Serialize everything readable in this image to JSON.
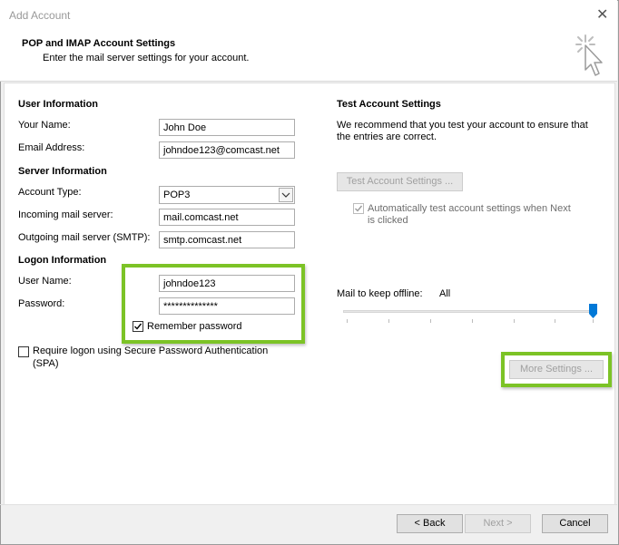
{
  "window": {
    "title": "Add Account",
    "close_glyph": "✕"
  },
  "header": {
    "title": "POP and IMAP Account Settings",
    "subtitle": "Enter the mail server settings for your account.",
    "icon": "cursor-click-icon"
  },
  "user_info": {
    "section_title": "User Information",
    "name_label": "Your Name:",
    "name_value": "John Doe",
    "email_label": "Email Address:",
    "email_value": "johndoe123@comcast.net"
  },
  "server_info": {
    "section_title": "Server Information",
    "account_type_label": "Account Type:",
    "account_type_value": "POP3",
    "incoming_label": "Incoming mail server:",
    "incoming_value": "mail.comcast.net",
    "outgoing_label": "Outgoing mail server (SMTP):",
    "outgoing_value": "smtp.comcast.net"
  },
  "logon_info": {
    "section_title": "Logon Information",
    "username_label": "User Name:",
    "username_value": "johndoe123",
    "password_label": "Password:",
    "password_value": "**************",
    "remember_label": "Remember password",
    "remember_checked": true,
    "spa_label_line1": "Require logon using Secure Password Authentication",
    "spa_label_line2": "(SPA)",
    "spa_checked": false
  },
  "test_settings": {
    "section_title": "Test Account Settings",
    "description_line1": "We recommend that you test your account to ensure that",
    "description_line2": "the entries are correct.",
    "test_button_label": "Test Account Settings ...",
    "auto_test_label_line1": "Automatically test account settings when Next",
    "auto_test_label_line2": "is clicked",
    "auto_test_checked": true
  },
  "offline": {
    "label": "Mail to keep offline:",
    "value": "All",
    "slider_level": 1.0
  },
  "more_settings_label": "More Settings ...",
  "footer": {
    "back_label": "< Back",
    "next_label": "Next >",
    "cancel_label": "Cancel"
  },
  "colors": {
    "highlight": "#7cc326",
    "slider_thumb": "#0078d7"
  }
}
